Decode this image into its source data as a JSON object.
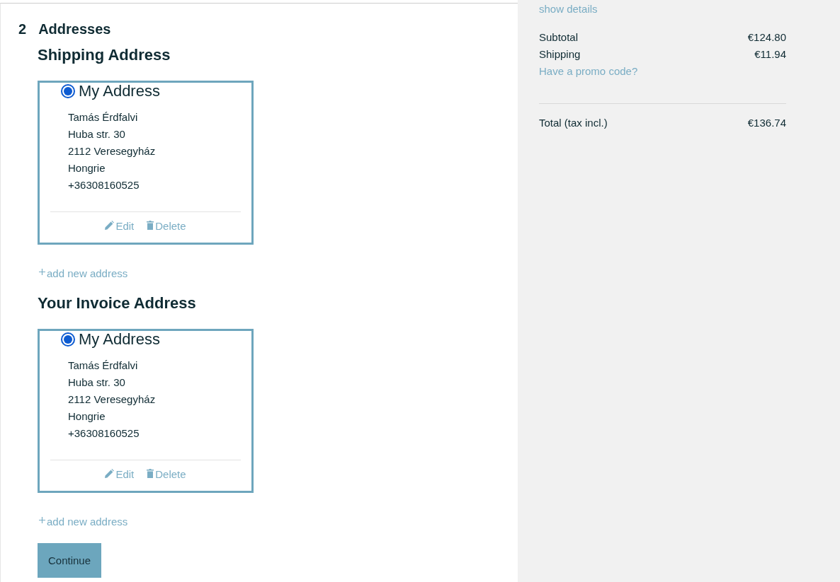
{
  "step": {
    "number": "2",
    "title": "Addresses"
  },
  "sections": [
    {
      "title": "Shipping Address",
      "addresses": [
        {
          "alias": "My Address",
          "selected": true,
          "lines": [
            "Tamás Érdfalvi",
            "Huba str. 30",
            "2112 Veresegyház",
            "Hongrie",
            "+36308160525"
          ],
          "actions": [
            {
              "kind": "edit",
              "label": "Edit"
            },
            {
              "kind": "delete",
              "label": "Delete"
            }
          ]
        }
      ],
      "add_link": "add new address"
    },
    {
      "title": "Your Invoice Address",
      "addresses": [
        {
          "alias": "My Address",
          "selected": true,
          "lines": [
            "Tamás Érdfalvi",
            "Huba str. 30",
            "2112 Veresegyház",
            "Hongrie",
            "+36308160525"
          ],
          "actions": [
            {
              "kind": "edit",
              "label": "Edit"
            },
            {
              "kind": "delete",
              "label": "Delete"
            }
          ]
        }
      ],
      "add_link": "add new address"
    }
  ],
  "continue_button": "Continue",
  "summary": {
    "details_link": "show details",
    "lines": [
      {
        "label": "Subtotal",
        "value": "€124.80"
      },
      {
        "label": "Shipping",
        "value": "€11.94"
      }
    ],
    "promo_link": "Have a promo code?",
    "total": {
      "label": "Total (tax incl.)",
      "value": "€136.74"
    }
  }
}
